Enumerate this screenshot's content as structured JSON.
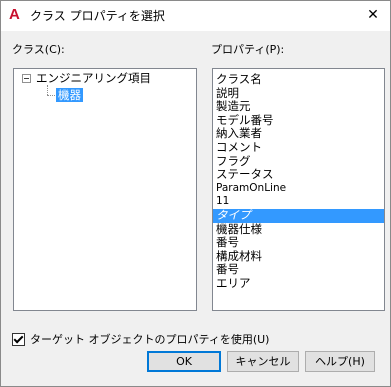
{
  "window": {
    "title": "クラス プロパティを選択",
    "app_icon_glyph": "A",
    "close_glyph": "✕"
  },
  "class_panel": {
    "label": "クラス(C):",
    "tree": {
      "root": "エンジニアリング項目",
      "child": "機器"
    }
  },
  "property_panel": {
    "label": "プロパティ(P):",
    "items": [
      "クラス名",
      "説明",
      "製造元",
      "モデル番号",
      "納入業者",
      "コメント",
      "フラグ",
      "ステータス",
      "ParamOnLine",
      "11",
      "タイプ",
      "機器仕様",
      "番号",
      "構成材料",
      "番号",
      "エリア"
    ],
    "selected_index": 10
  },
  "target_checkbox": {
    "label": "ターゲット オブジェクトのプロパティを使用(U)",
    "checked": true
  },
  "buttons": {
    "ok": "OK",
    "cancel": "キャンセル",
    "help": "ヘルプ(H)"
  },
  "colors": {
    "selection": "#3399ff",
    "brand_icon": "#c8102e",
    "default_button_border": "#0078d7"
  }
}
